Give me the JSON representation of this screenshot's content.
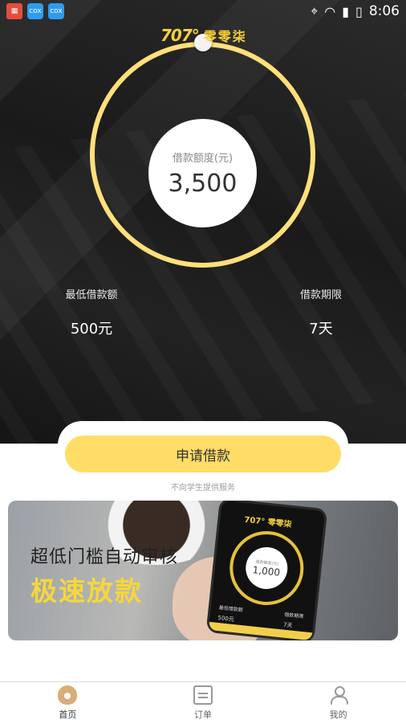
{
  "status_bar": {
    "time": "8:06",
    "icons": [
      "location-icon",
      "wifi-icon",
      "signal-icon",
      "battery-charging-icon"
    ],
    "apps": [
      "news-app-icon",
      "cox-app-icon",
      "cox-app-icon"
    ]
  },
  "brand": {
    "logo_mark": "707°",
    "logo_text": "零零柒",
    "accent_color": "#ffdd66"
  },
  "loan": {
    "amount_label": "借款额度(元)",
    "amount_value": "3,500",
    "min_label": "最低借款额",
    "min_value": "500元",
    "term_label": "借款期限",
    "term_value": "7天"
  },
  "apply": {
    "button_label": "申请借款",
    "note": "不向学生提供服务"
  },
  "banner": {
    "line1": "超低门槛自动审核",
    "line2": "极速放款",
    "phone_logo": "707° 零零柒",
    "phone_amount_label": "借款额度(元)",
    "phone_amount": "1,000",
    "phone_min_label": "最低借款额",
    "phone_min_value": "500元",
    "phone_term_label": "借款期限",
    "phone_term_value": "7天"
  },
  "nav": {
    "home": "首页",
    "orders": "订单",
    "me": "我的"
  }
}
